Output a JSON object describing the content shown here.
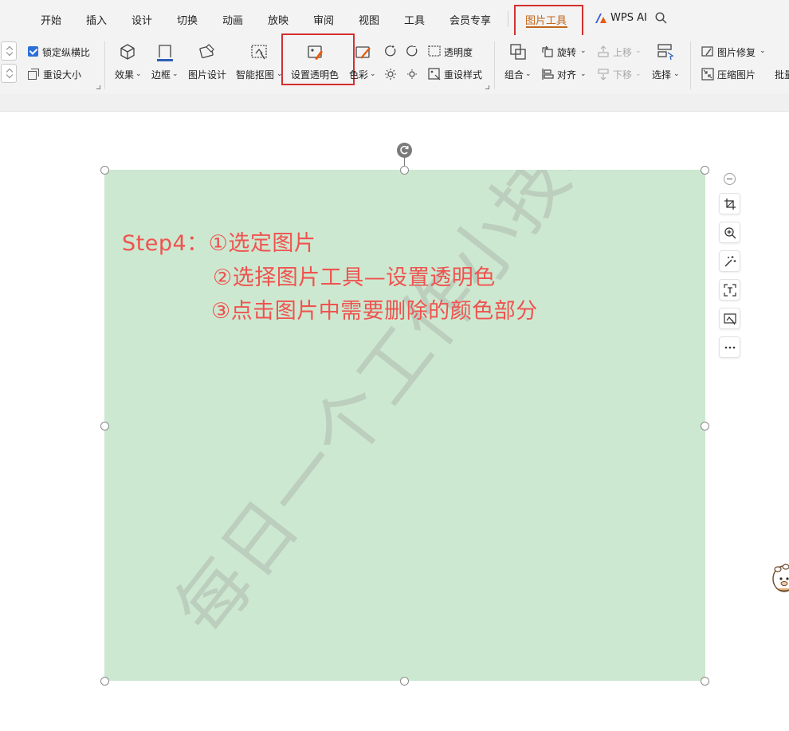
{
  "tabs": {
    "home": "开始",
    "insert": "插入",
    "design": "设计",
    "transition": "切换",
    "animation": "动画",
    "slideshow": "放映",
    "review": "审阅",
    "view": "视图",
    "tools": "工具",
    "member": "会员专享",
    "picture_tools": "图片工具",
    "wps_ai": "WPS AI"
  },
  "ribbon": {
    "lock_ratio": "锁定纵横比",
    "reset_size": "重设大小",
    "effect": "效果",
    "border": "边框",
    "picture_design": "图片设计",
    "smart_cutout": "智能抠图",
    "set_transparent_color": "设置透明色",
    "color": "色彩",
    "transparency": "透明度",
    "reset_style": "重设样式",
    "rotate": "旋转",
    "move_up": "上移",
    "group": "组合",
    "align": "对齐",
    "move_down": "下移",
    "select": "选择",
    "picture_repair": "图片修复",
    "compress_picture": "压缩图片",
    "batch": "批量"
  },
  "slide": {
    "step_line1": "Step4：①选定图片",
    "step_line2": "②选择图片工具—设置透明色",
    "step_line3": "③点击图片中需要删除的颜色部分",
    "watermark": "每日一个工作小技巧"
  },
  "colors": {
    "accent_red": "#d32f2f",
    "active_tab": "#c2661b",
    "picture_bg": "#cde8d0",
    "step_text": "#ef5350",
    "checkbox": "#2c6fd8"
  },
  "icons": {
    "floating_toolbar": [
      "minus-icon",
      "crop-icon",
      "zoom-in-icon",
      "magic-wand-icon",
      "text-extract-icon",
      "smart-cutout-icon",
      "more-icon"
    ]
  }
}
